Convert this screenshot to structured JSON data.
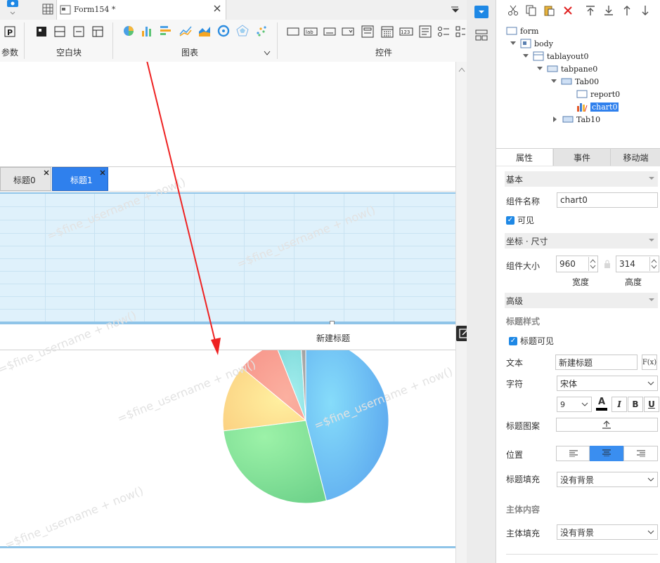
{
  "editor": {
    "file_tab": "Form154 *",
    "toolbar_groups": {
      "params": "参数",
      "blank": "空白块",
      "chart": "图表",
      "widget": "控件"
    },
    "widget_icon_text": {
      "label": "lab",
      "number": "123"
    }
  },
  "canvas": {
    "tabs": [
      {
        "label": "标题0",
        "active": false
      },
      {
        "label": "标题1",
        "active": true
      }
    ],
    "chart_title": "新建标题",
    "watermark": "=$fine_username + now()"
  },
  "chart_data": {
    "type": "pie",
    "title": "新建标题",
    "slices": [
      {
        "value": 46,
        "color": "#6ab8f5"
      },
      {
        "value": 27,
        "color": "#86e39c"
      },
      {
        "value": 13,
        "color": "#fbdb8a"
      },
      {
        "value": 8,
        "color": "#f99e90"
      },
      {
        "value": 5,
        "color": "#8ee3e3"
      },
      {
        "value": 1,
        "color": "#a0a0a0"
      }
    ]
  },
  "tree": {
    "nodes": [
      {
        "label": "form"
      },
      {
        "label": "body"
      },
      {
        "label": "tablayout0"
      },
      {
        "label": "tabpane0"
      },
      {
        "label": "Tab00"
      },
      {
        "label": "report0"
      },
      {
        "label": "chart0",
        "selected": true
      },
      {
        "label": "Tab10"
      }
    ]
  },
  "panel": {
    "tabs": [
      {
        "label": "属性",
        "active": true
      },
      {
        "label": "事件"
      },
      {
        "label": "移动端"
      }
    ],
    "basic": {
      "section": "基本",
      "name_label": "组件名称",
      "name_value": "chart0",
      "visible_label": "可见"
    },
    "coords": {
      "section": "坐标 · 尺寸",
      "size_label": "组件大小",
      "width": "960",
      "height": "314",
      "width_label": "宽度",
      "height_label": "高度"
    },
    "advanced": {
      "section": "高级",
      "title_style": "标题样式",
      "title_visible": "标题可见",
      "text_label": "文本",
      "text_value": "新建标题",
      "formula_btn": "F(x)",
      "font_label": "字符",
      "font_value": "宋体",
      "font_size": "9",
      "bold": "B",
      "italic": "I",
      "underline": "U",
      "font_color": "A",
      "pattern_label": "标题图案",
      "position_label": "位置",
      "title_fill_label": "标题填充",
      "title_fill_value": "没有背景",
      "body_section": "主体内容",
      "body_fill_label": "主体填充",
      "body_fill_value": "没有背景"
    }
  },
  "colors": {
    "accent": "#1e88e5",
    "selection": "#2f80ed",
    "arrow": "#ee2222"
  }
}
